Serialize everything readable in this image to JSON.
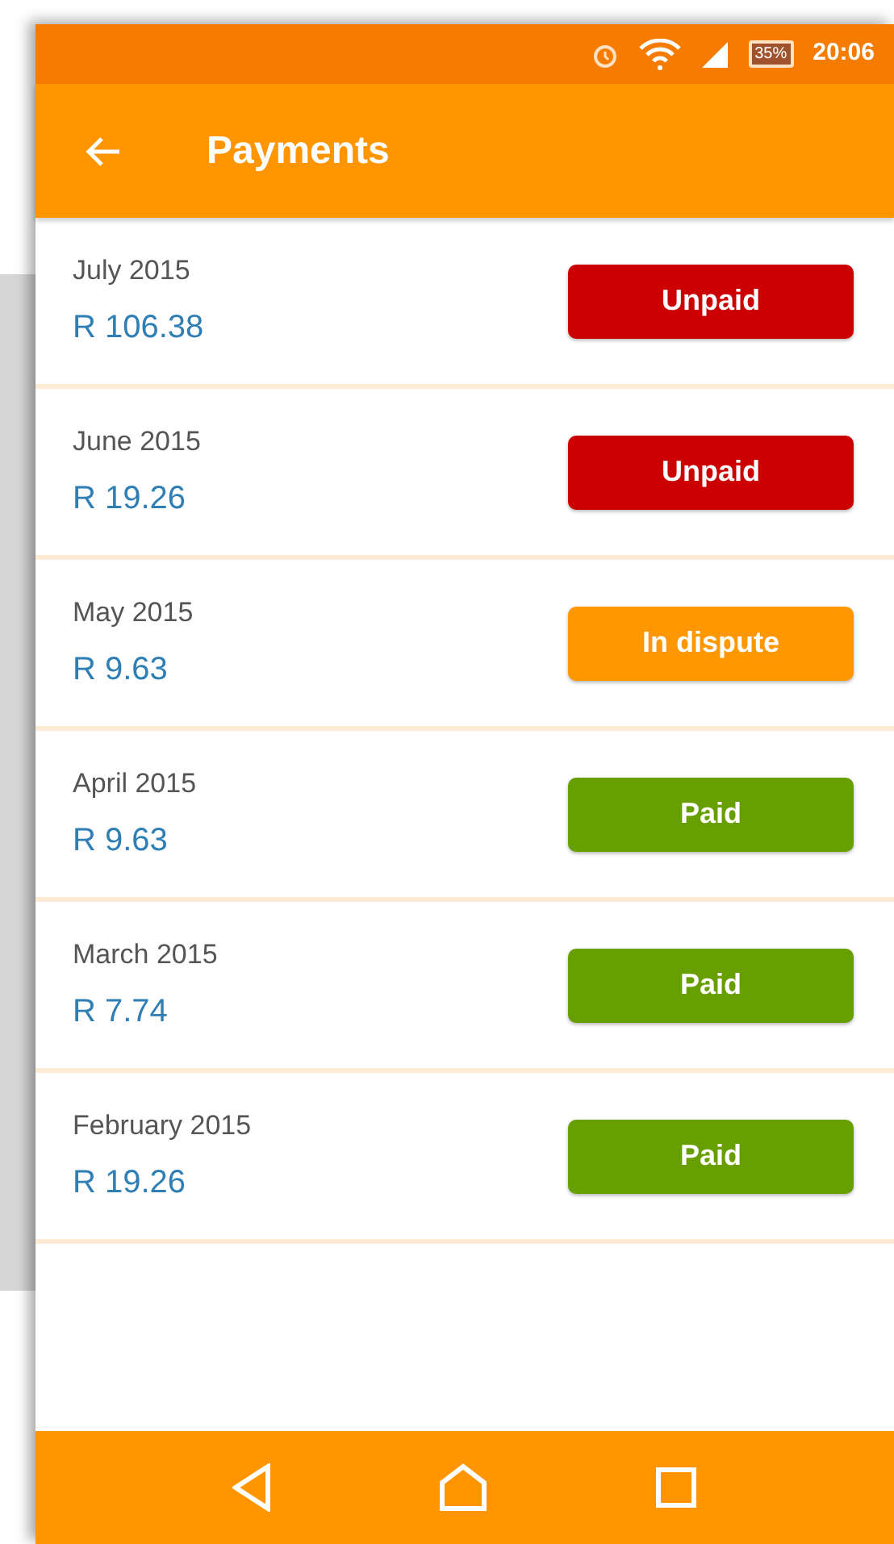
{
  "status_bar": {
    "battery": "35%",
    "time": "20:06"
  },
  "toolbar": {
    "title": "Payments"
  },
  "payments": [
    {
      "month": "July 2015",
      "amount": "R 106.38",
      "status": "Unpaid",
      "kind": "unpaid"
    },
    {
      "month": "June 2015",
      "amount": "R 19.26",
      "status": "Unpaid",
      "kind": "unpaid"
    },
    {
      "month": "May 2015",
      "amount": "R 9.63",
      "status": "In dispute",
      "kind": "dispute"
    },
    {
      "month": "April 2015",
      "amount": "R 9.63",
      "status": "Paid",
      "kind": "paid"
    },
    {
      "month": "March 2015",
      "amount": "R 7.74",
      "status": "Paid",
      "kind": "paid"
    },
    {
      "month": "February 2015",
      "amount": "R 19.26",
      "status": "Paid",
      "kind": "paid"
    }
  ]
}
